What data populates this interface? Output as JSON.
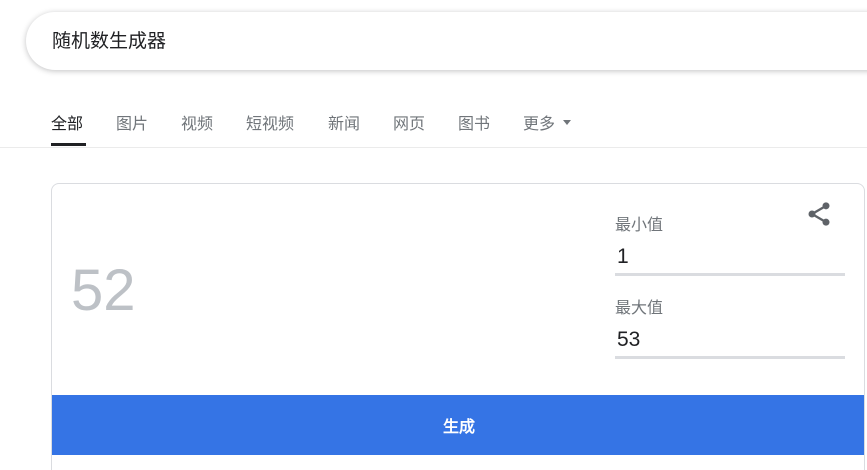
{
  "search": {
    "query": "随机数生成器"
  },
  "tabs": [
    {
      "label": "全部",
      "active": true
    },
    {
      "label": "图片"
    },
    {
      "label": "视频"
    },
    {
      "label": "短视频"
    },
    {
      "label": "新闻"
    },
    {
      "label": "网页"
    },
    {
      "label": "图书"
    },
    {
      "label": "更多"
    }
  ],
  "rng": {
    "result": "52",
    "min_label": "最小值",
    "min_value": "1",
    "max_label": "最大值",
    "max_value": "53",
    "generate_label": "生成",
    "share_icon": "share-icon"
  },
  "colors": {
    "accent": "#3574e5",
    "result_text": "#bdc1c6"
  }
}
